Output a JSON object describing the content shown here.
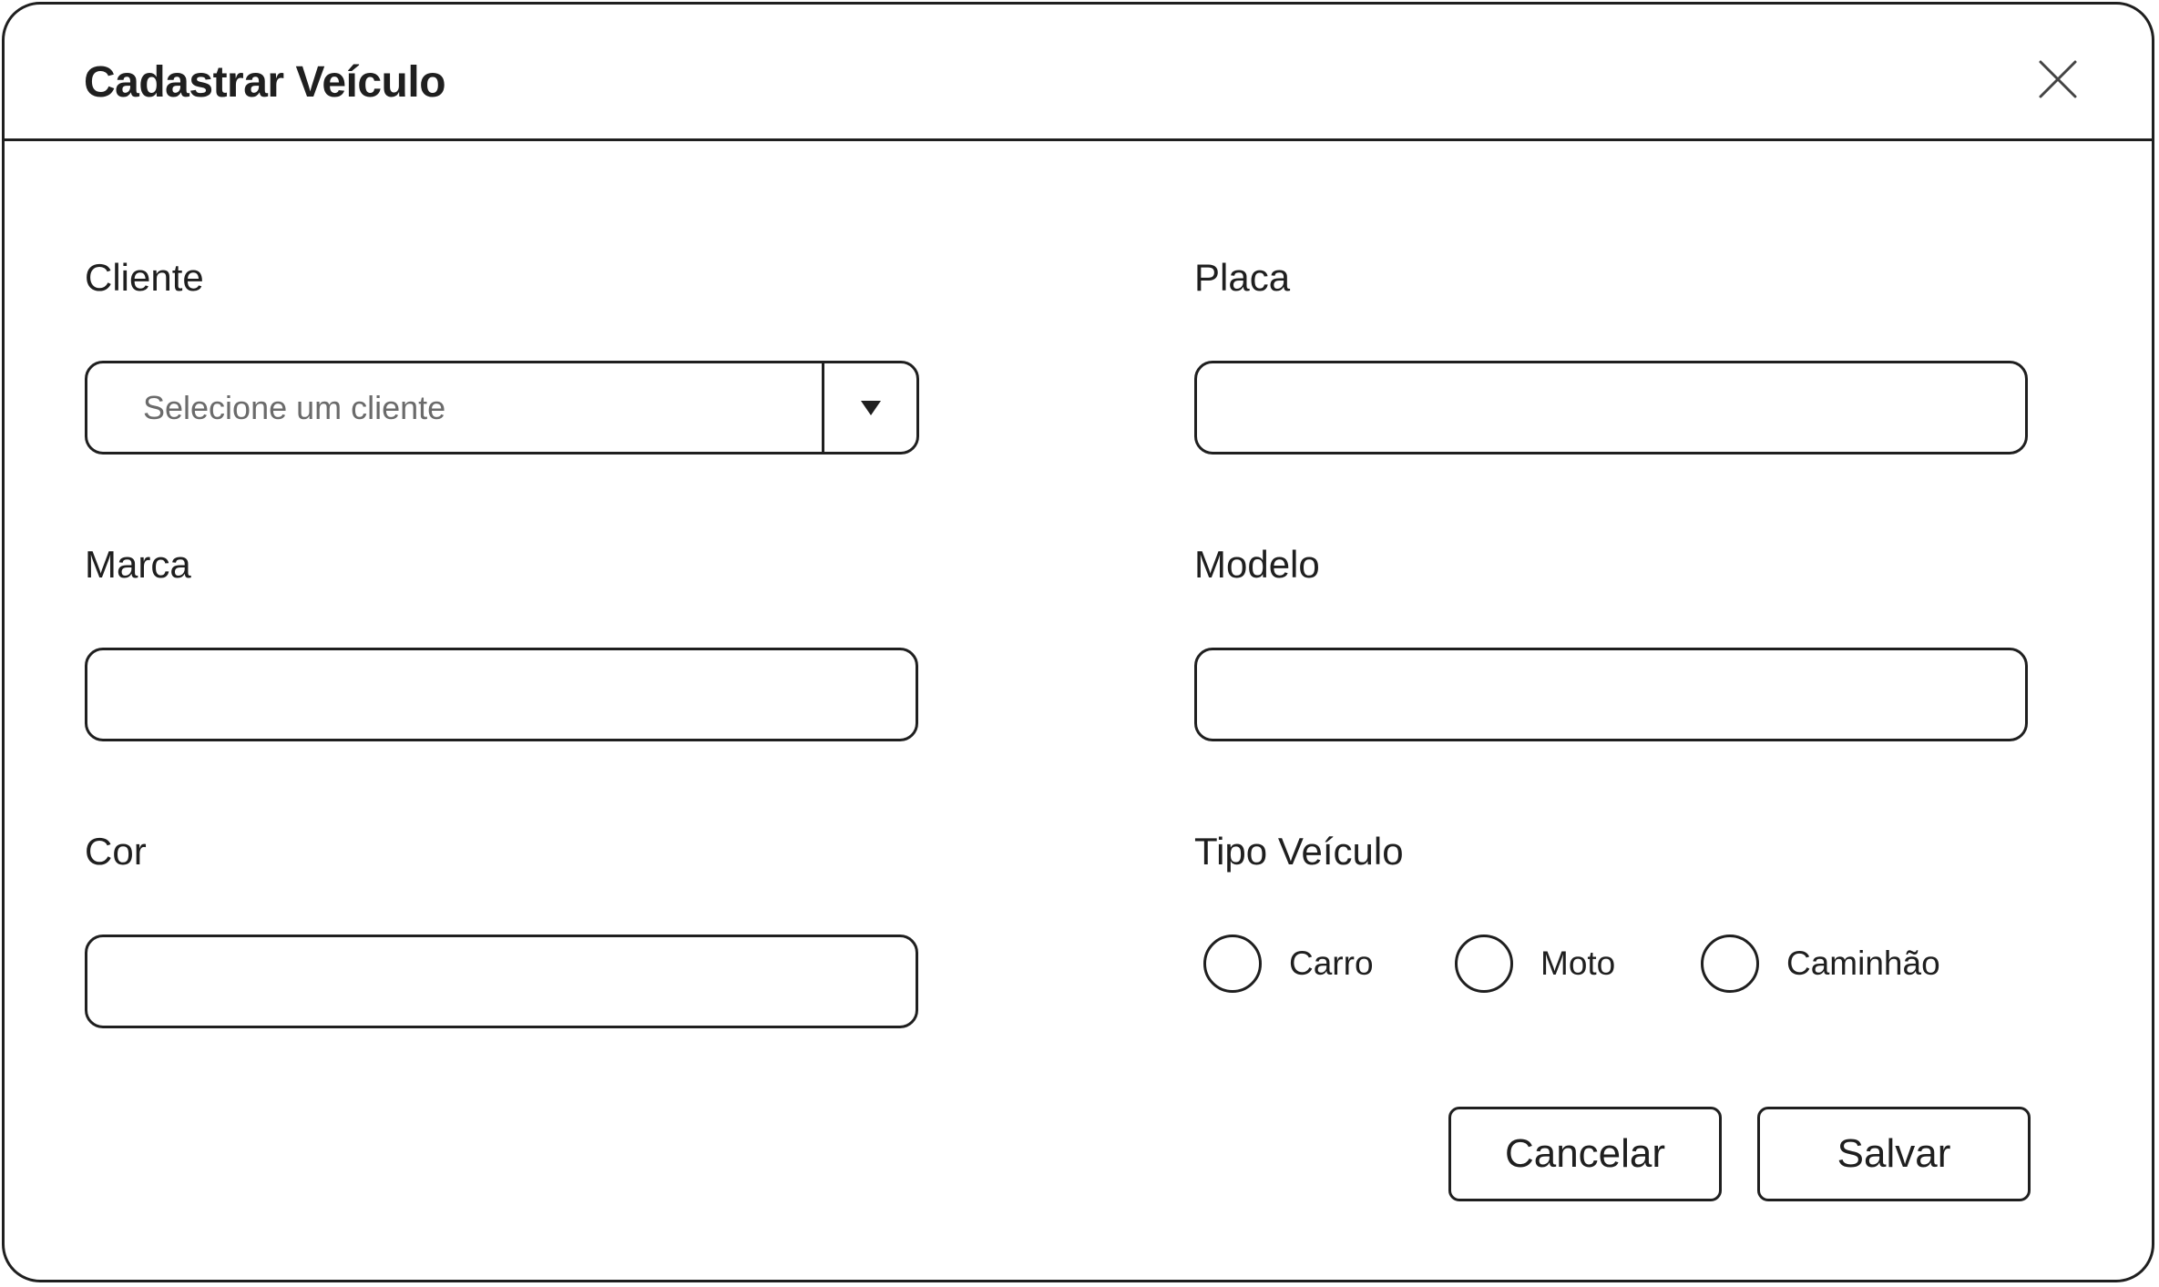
{
  "dialog": {
    "title": "Cadastrar Veículo",
    "close_icon": "close-icon"
  },
  "form": {
    "cliente": {
      "label": "Cliente",
      "placeholder": "Selecione um cliente",
      "value": "",
      "dropdown_icon": "triangle-down-icon"
    },
    "placa": {
      "label": "Placa",
      "value": ""
    },
    "marca": {
      "label": "Marca",
      "value": ""
    },
    "modelo": {
      "label": "Modelo",
      "value": ""
    },
    "cor": {
      "label": "Cor",
      "value": ""
    },
    "tipo_veiculo": {
      "label": "Tipo Veículo",
      "options": [
        {
          "label": "Carro",
          "selected": false
        },
        {
          "label": "Moto",
          "selected": false
        },
        {
          "label": "Caminhão",
          "selected": false
        }
      ]
    }
  },
  "actions": {
    "cancel_label": "Cancelar",
    "save_label": "Salvar"
  },
  "colors": {
    "border": "#1f1f1f",
    "background": "#ffffff",
    "placeholder_text": "#6b6b6b"
  }
}
